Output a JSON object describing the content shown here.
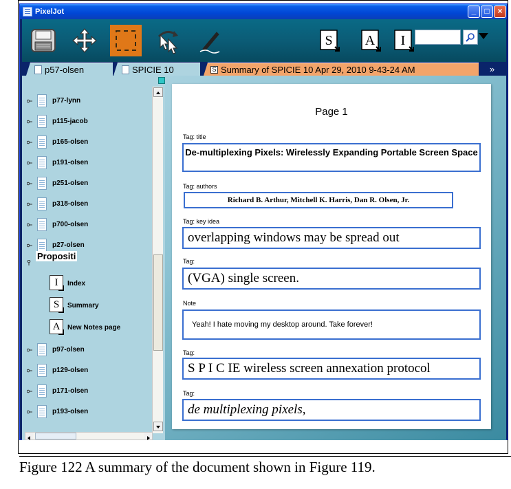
{
  "window": {
    "title": "PixelJot"
  },
  "toolbar": {
    "tools": [
      {
        "icon": "save-icon"
      },
      {
        "icon": "move-icon"
      },
      {
        "icon": "select-region-icon",
        "active": true
      },
      {
        "icon": "rotate-cursor-icon"
      },
      {
        "icon": "pen-icon"
      },
      {
        "icon": "summary-s-icon"
      },
      {
        "icon": "notes-a-icon"
      },
      {
        "icon": "index-i-icon"
      }
    ],
    "search_value": ""
  },
  "tabs": [
    {
      "label": "p57-olsen"
    },
    {
      "label": "SPICIE 10"
    },
    {
      "label": "Summary of SPICIE 10 Apr 29, 2010 9-43-24 AM",
      "active": true
    }
  ],
  "tab_overflow": "»",
  "sidebar": {
    "items_top": [
      {
        "label": "p77-lynn"
      },
      {
        "label": "p115-jacob"
      },
      {
        "label": "p165-olsen"
      },
      {
        "label": "p191-olsen"
      },
      {
        "label": "p251-olsen"
      },
      {
        "label": "p318-olsen"
      },
      {
        "label": "p700-olsen"
      },
      {
        "label": "p27-olsen"
      }
    ],
    "expanded": {
      "label": "Propositi",
      "children": [
        {
          "glyph": "I",
          "label": "Index"
        },
        {
          "glyph": "S",
          "label": "Summary"
        },
        {
          "glyph": "A",
          "label": "New Notes page"
        }
      ]
    },
    "items_bottom": [
      {
        "label": "p97-olsen"
      },
      {
        "label": "p129-olsen"
      },
      {
        "label": "p171-olsen"
      },
      {
        "label": "p193-olsen"
      }
    ]
  },
  "page": {
    "heading": "Page 1",
    "fields": [
      {
        "tag": "Tag: title",
        "text": "De-multiplexing Pixels: Wirelessly Expanding Portable Screen Space"
      },
      {
        "tag": "Tag: authors",
        "text": "Richard B. Arthur, Mitchell K. Harris, Dan R. Olsen, Jr."
      },
      {
        "tag": "Tag: key idea",
        "text": "overlapping windows may be spread out"
      },
      {
        "tag": "Tag:",
        "text": "(VGA) single screen."
      },
      {
        "tag": "Note",
        "text": "Yeah! I hate moving my desktop around. Take forever!"
      },
      {
        "tag": "Tag:",
        "text": "S P I C IE wireless screen annexation protocol"
      },
      {
        "tag": "Tag:",
        "text": "de multiplexing pixels,"
      }
    ]
  },
  "caption": "Figure 122  A summary of the document shown in Figure 119.",
  "colors": {
    "accent_orange": "#e07818",
    "field_border": "#3a6fd0",
    "toolbar_teal": "#0a6a86",
    "sidebar_bg": "#aed4e0"
  }
}
